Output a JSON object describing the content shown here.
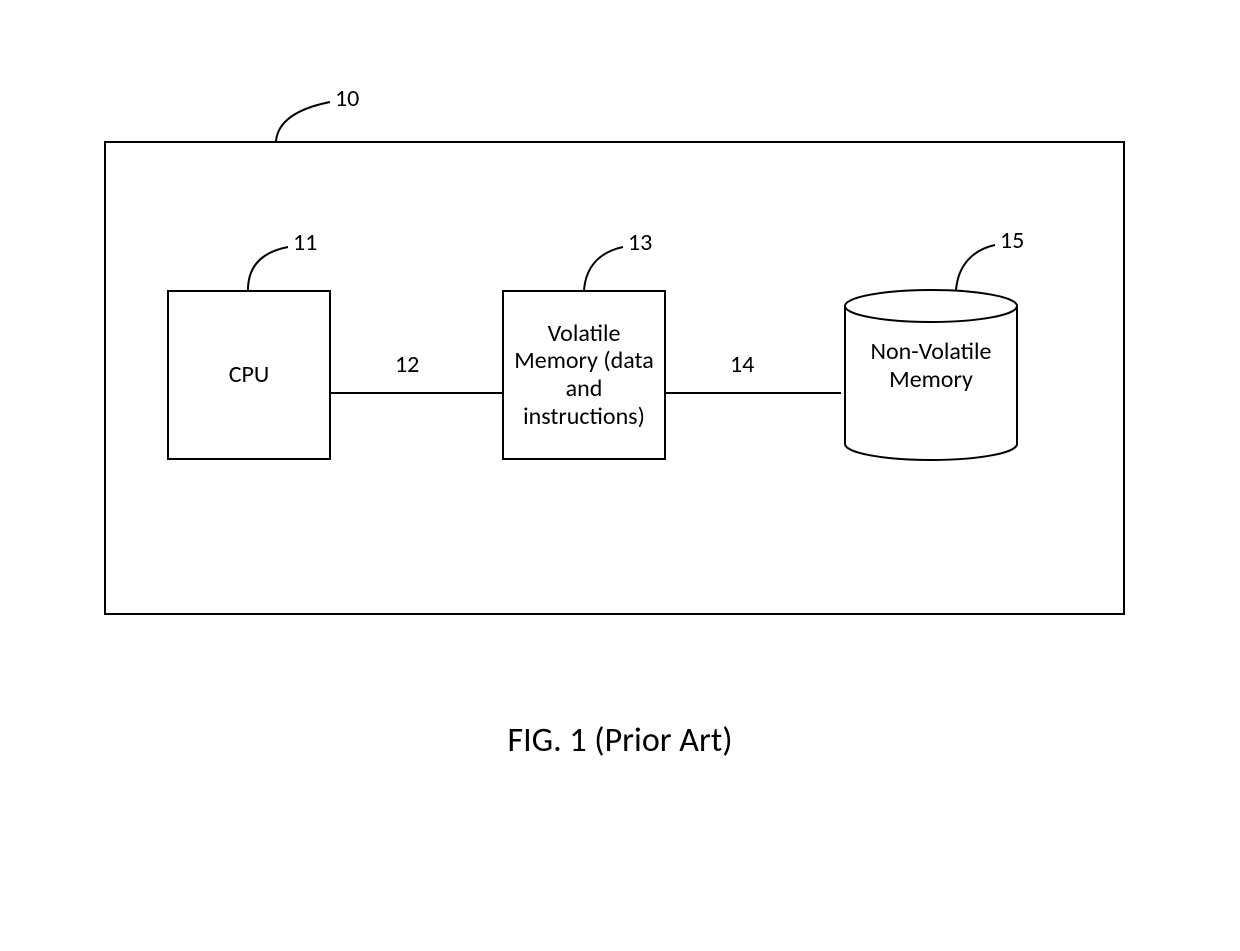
{
  "figure": {
    "caption": "FIG. 1   (Prior Art)"
  },
  "refs": {
    "outer": "10",
    "cpu": "11",
    "link_cpu_vmem": "12",
    "vmem": "13",
    "link_vmem_nvm": "14",
    "nvm": "15"
  },
  "blocks": {
    "cpu": "CPU",
    "vmem": "Volatile Memory (data and instructions)",
    "nvm_line1": "Non-Volatile",
    "nvm_line2": "Memory"
  }
}
